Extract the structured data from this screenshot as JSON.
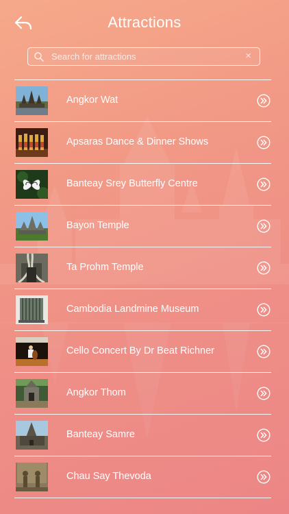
{
  "header": {
    "title": "Attractions",
    "back_icon": "back-arrow-icon"
  },
  "search": {
    "placeholder": "Search for attractions",
    "value": "",
    "clear_glyph": "×"
  },
  "colors": {
    "background_top": "#f6a98a",
    "background_bottom": "#ec8686",
    "text": "#ffffff"
  },
  "attractions": [
    {
      "label": "Angkor Wat",
      "thumb": "angkor-wat-photo"
    },
    {
      "label": "Apsaras Dance & Dinner Shows",
      "thumb": "apsara-dancers-photo"
    },
    {
      "label": "Banteay Srey Butterfly Centre",
      "thumb": "butterfly-photo"
    },
    {
      "label": "Bayon Temple",
      "thumb": "bayon-temple-photo"
    },
    {
      "label": "Ta Prohm Temple",
      "thumb": "ta-prohm-photo"
    },
    {
      "label": "Cambodia Landmine Museum",
      "thumb": "landmine-museum-photo"
    },
    {
      "label": "Cello Concert By Dr Beat Richner",
      "thumb": "cello-concert-photo"
    },
    {
      "label": "Angkor Thom",
      "thumb": "angkor-thom-photo"
    },
    {
      "label": "Banteay Samre",
      "thumb": "banteay-samre-photo"
    },
    {
      "label": "Chau Say Thevoda",
      "thumb": "chau-say-thevoda-photo"
    }
  ]
}
